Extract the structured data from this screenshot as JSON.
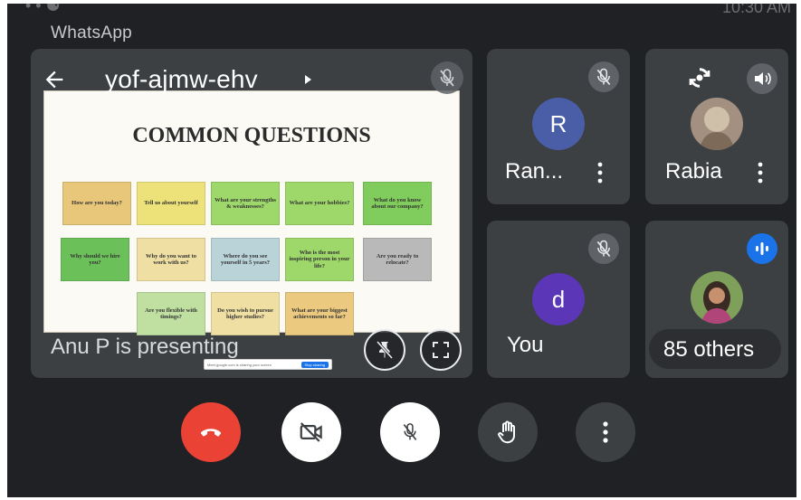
{
  "app": {
    "label": "WhatsApp"
  },
  "status": {
    "clock": "10:30 AM",
    "dots": "• • ⚈"
  },
  "presentation": {
    "meeting_code": "yof-ajmw-ehv",
    "presenter_label": "Anu P is presenting",
    "slide": {
      "title": "COMMON QUESTIONS",
      "cards": [
        {
          "text": "How are you today?",
          "color": "#e8c67a"
        },
        {
          "text": "Tell us about yourself",
          "color": "#ede27a"
        },
        {
          "text": "What are your strengths & weaknesses?",
          "color": "#9ed86a"
        },
        {
          "text": "What are your hobbies?",
          "color": "#9ed86a"
        },
        {
          "text": "What do you know about our company?",
          "color": "#80cc5c"
        },
        {
          "text": "Why should we hire you?",
          "color": "#6cc05a"
        },
        {
          "text": "Why do you want to work with us?",
          "color": "#f0dfa3"
        },
        {
          "text": "Where do you see yourself in 5 years?",
          "color": "#b9d3d9"
        },
        {
          "text": "Who is the most inspiring person in your life?",
          "color": "#9ed86a"
        },
        {
          "text": "Are you ready to relocate?",
          "color": "#b9b9b9"
        },
        {
          "text": "Are you flexible with timings?",
          "color": "#bfe0a0"
        },
        {
          "text": "Do you wish to pursue higher studies?",
          "color": "#f0dfa3"
        },
        {
          "text": "What are your biggest achievements so far?",
          "color": "#ebca7f"
        }
      ],
      "meet_bar": {
        "text": "Meet.google.com is sharing your screen",
        "button": "Stop sharing"
      }
    }
  },
  "participants": [
    {
      "name": "Ran...",
      "initial": "R",
      "avatar_color": "#4a5ea8"
    },
    {
      "name": "Rabia",
      "initial": "",
      "avatar_color": "#b9a28a"
    },
    {
      "name": "You",
      "initial": "d",
      "avatar_color": "#5b36b6"
    },
    {
      "name": "85 others",
      "initial": "",
      "avatar_color": "#6c8b4c"
    }
  ],
  "colors": {
    "end_call": "#ea4335",
    "tile": "#3c4043",
    "bg": "#202124",
    "accent": "#1a73e8"
  }
}
